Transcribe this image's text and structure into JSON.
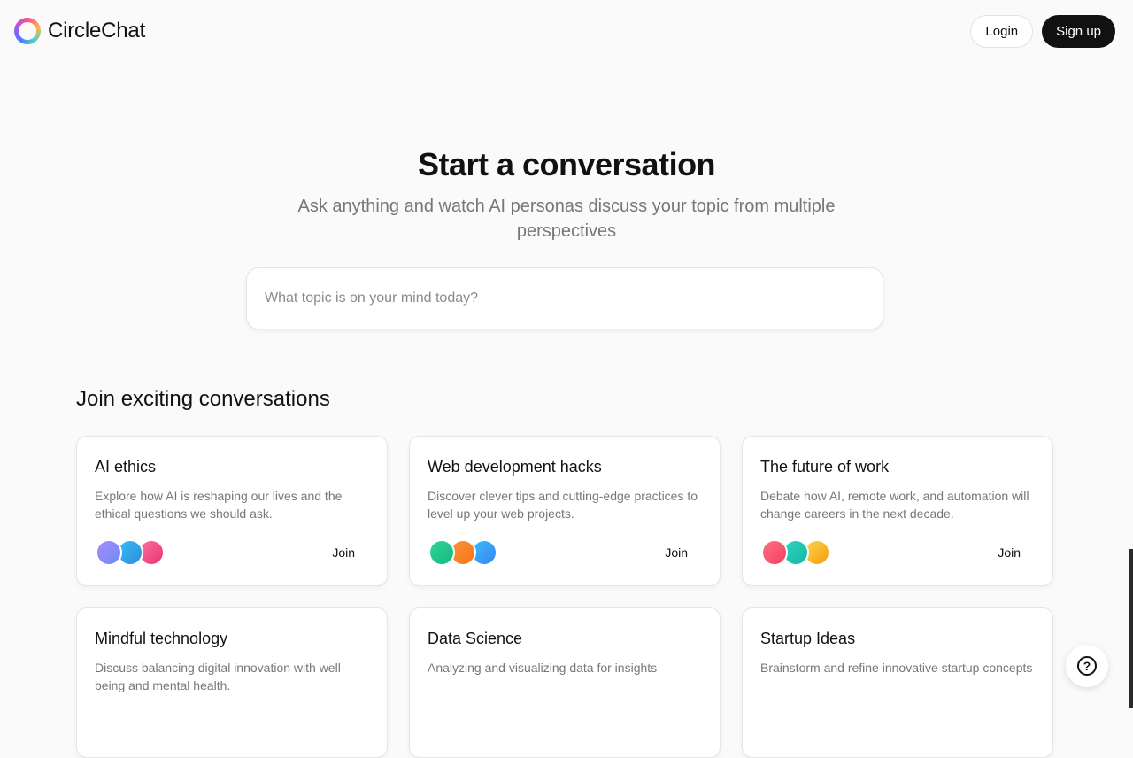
{
  "header": {
    "brand_name": "CircleChat",
    "login_label": "Login",
    "signup_label": "Sign up"
  },
  "hero": {
    "title": "Start a conversation",
    "subtitle": "Ask anything and watch AI personas discuss your topic from multiple perspectives",
    "search_placeholder": "What topic is on your mind today?",
    "search_value": ""
  },
  "section": {
    "title": "Join exciting conversations"
  },
  "cards": [
    {
      "title": "AI ethics",
      "description": "Explore how AI is reshaping our lives and the ethical questions we should ask.",
      "join_label": "Join",
      "avatar_colors": [
        [
          "#a78bfa",
          "#6d8bf5"
        ],
        [
          "#38bdf8",
          "#2d8cd6"
        ],
        [
          "#ff6fa0",
          "#e9356e"
        ]
      ]
    },
    {
      "title": "Web development hacks",
      "description": "Discover clever tips and cutting-edge practices to level up your web projects.",
      "join_label": "Join",
      "avatar_colors": [
        [
          "#34d399",
          "#10b981"
        ],
        [
          "#fb923c",
          "#f97316"
        ],
        [
          "#38bdf8",
          "#3b82f6"
        ]
      ]
    },
    {
      "title": "The future of work",
      "description": "Debate how AI, remote work, and automation will change careers in the next decade.",
      "join_label": "Join",
      "avatar_colors": [
        [
          "#fb7185",
          "#f43f5e"
        ],
        [
          "#2dd4bf",
          "#14b8a6"
        ],
        [
          "#fcd34d",
          "#f59e0b"
        ]
      ]
    },
    {
      "title": "Mindful technology",
      "description": "Discuss balancing digital innovation with well-being and mental health.",
      "join_label": "",
      "avatar_colors": []
    },
    {
      "title": "Data Science",
      "description": "Analyzing and visualizing data for insights",
      "join_label": "",
      "avatar_colors": []
    },
    {
      "title": "Startup Ideas",
      "description": "Brainstorm and refine innovative startup concepts",
      "join_label": "",
      "avatar_colors": []
    }
  ],
  "help": {
    "icon": "help-circle-icon",
    "glyph": "?"
  }
}
